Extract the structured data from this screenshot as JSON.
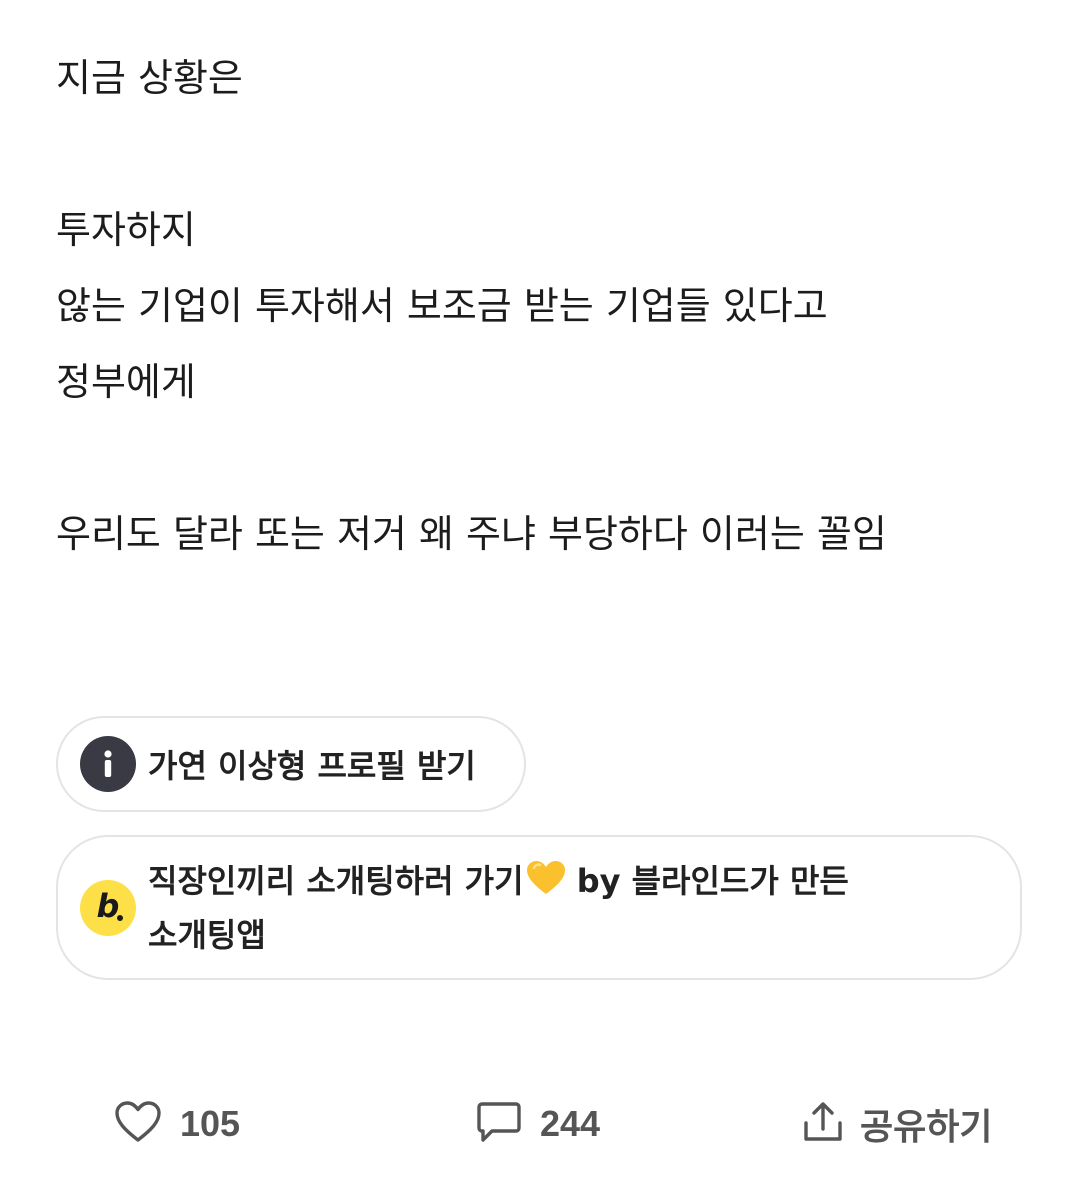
{
  "post": {
    "lines": [
      "지금 상황은",
      "",
      "투자하지",
      "않는 기업이 투자해서 보조금 받는 기업들 있다고",
      "정부에게",
      "",
      "우리도 달라 또는 저거 왜 주냐 부당하다 이러는 꼴임"
    ]
  },
  "chips": {
    "profile": {
      "icon": "info-icon",
      "label": "가연 이상형 프로필 받기"
    },
    "dating": {
      "icon": "blind-b-logo",
      "label_part1": "직장인끼리 소개팅하러 가기",
      "label_part2": " by 블라인드가 만든",
      "label_line2": "소개팅앱"
    }
  },
  "actions": {
    "like_count": "105",
    "comment_count": "244",
    "share_label": "공유하기"
  },
  "colors": {
    "text": "#1c1c1c",
    "chip_border": "#e4e4e7",
    "info_icon_bg": "#3a3a44",
    "blind_logo_bg": "#fde047",
    "action_gray": "#555555"
  }
}
